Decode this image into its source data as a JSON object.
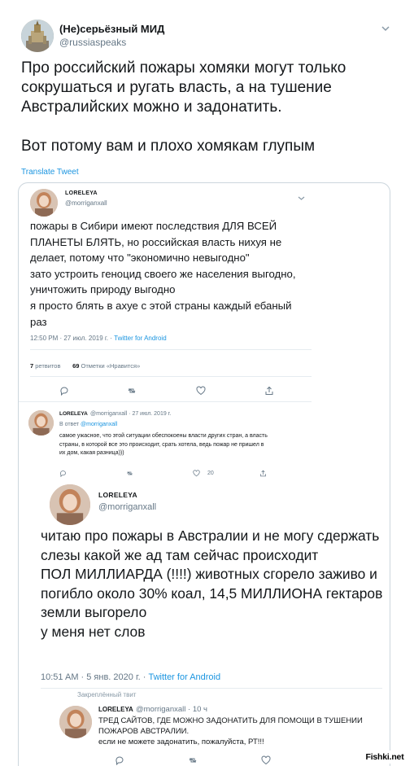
{
  "outer_tweet": {
    "author_name": "(Не)серьёзный МИД",
    "author_handle": "@russiaspeaks",
    "paragraphs": [
      "Про российский пожары хомяки могут только сокрушаться и ругать власть, а на тушение Австралийских можно и задонатить.",
      "Вот потому вам и плохо хомякам глупым"
    ],
    "translate_label": "Translate Tweet"
  },
  "quoted": {
    "tweet1": {
      "author_name": "LORELEYA",
      "author_handle": "@morriganxall",
      "text": "пожары в Сибири имеют последствия ДЛЯ ВСЕЙ ПЛАНЕТЫ БЛЯТЬ, но российская власть нихуя не делает, потому что \"экономично невыгодно\"\nзато устроить геноцид своего же населения выгодно, уничтожить природу выгодно\nя просто блять в ахуе с этой страны каждый ебаный раз",
      "time": "12:50 PM · 27 июл. 2019 г. · ",
      "client": "Twitter for Android",
      "retweets_count": "7",
      "retweets_label": " ретвитов",
      "likes_count": "69",
      "likes_label": " Отметки «Нравится»"
    },
    "tweet2": {
      "author_name": "LORELEYA",
      "author_handle": "@morriganxall · 27 июл. 2019 г.",
      "reply_prefix": "В ответ ",
      "reply_to": "@morriganxall",
      "text": "самое ужасное, что этой ситуации обеспокоены власти других стран, а власть страны, в которой все это происходит, срать хотела, ведь пожар не пришел в их дом, какая разница)))",
      "like_count": "20"
    },
    "tweet3": {
      "author_name": "LORELEYA",
      "author_handle": "@morriganxall",
      "text": "читаю про пожары в Австралии и не могу сдержать слезы какой же ад там сейчас происходит\nПОЛ МИЛЛИАРДА (!!!!) животных сгорело заживо и погибло около 30% коал, 14,5 МИЛЛИОНА гектаров земли выгорело\nу меня нет слов",
      "time": "10:51 AM · 5 янв. 2020 г. · ",
      "client": "Twitter for Android",
      "pinned_label": "Закреплённый твит"
    },
    "tweet4": {
      "author_name": "LORELEYA",
      "author_handle": "@morriganxall · 10 ч",
      "text": "ТРЕД САЙТОВ, ГДЕ МОЖНО ЗАДОНАТИТЬ ДЛЯ ПОМОЩИ В ТУШЕНИИ ПОЖАРОВ АВСТРАЛИИ.\nесли не можете задонатить, пожалуйста, РТ!!!"
    }
  },
  "watermark": "Fishki.net",
  "icons": {
    "chevron": "chevron-down-icon",
    "reply": "reply-icon",
    "retweet": "retweet-icon",
    "like": "heart-icon",
    "share": "share-icon"
  },
  "colors": {
    "link_blue": "#1b95e0",
    "secondary_text": "#657786",
    "border": "#ccd6dd"
  }
}
